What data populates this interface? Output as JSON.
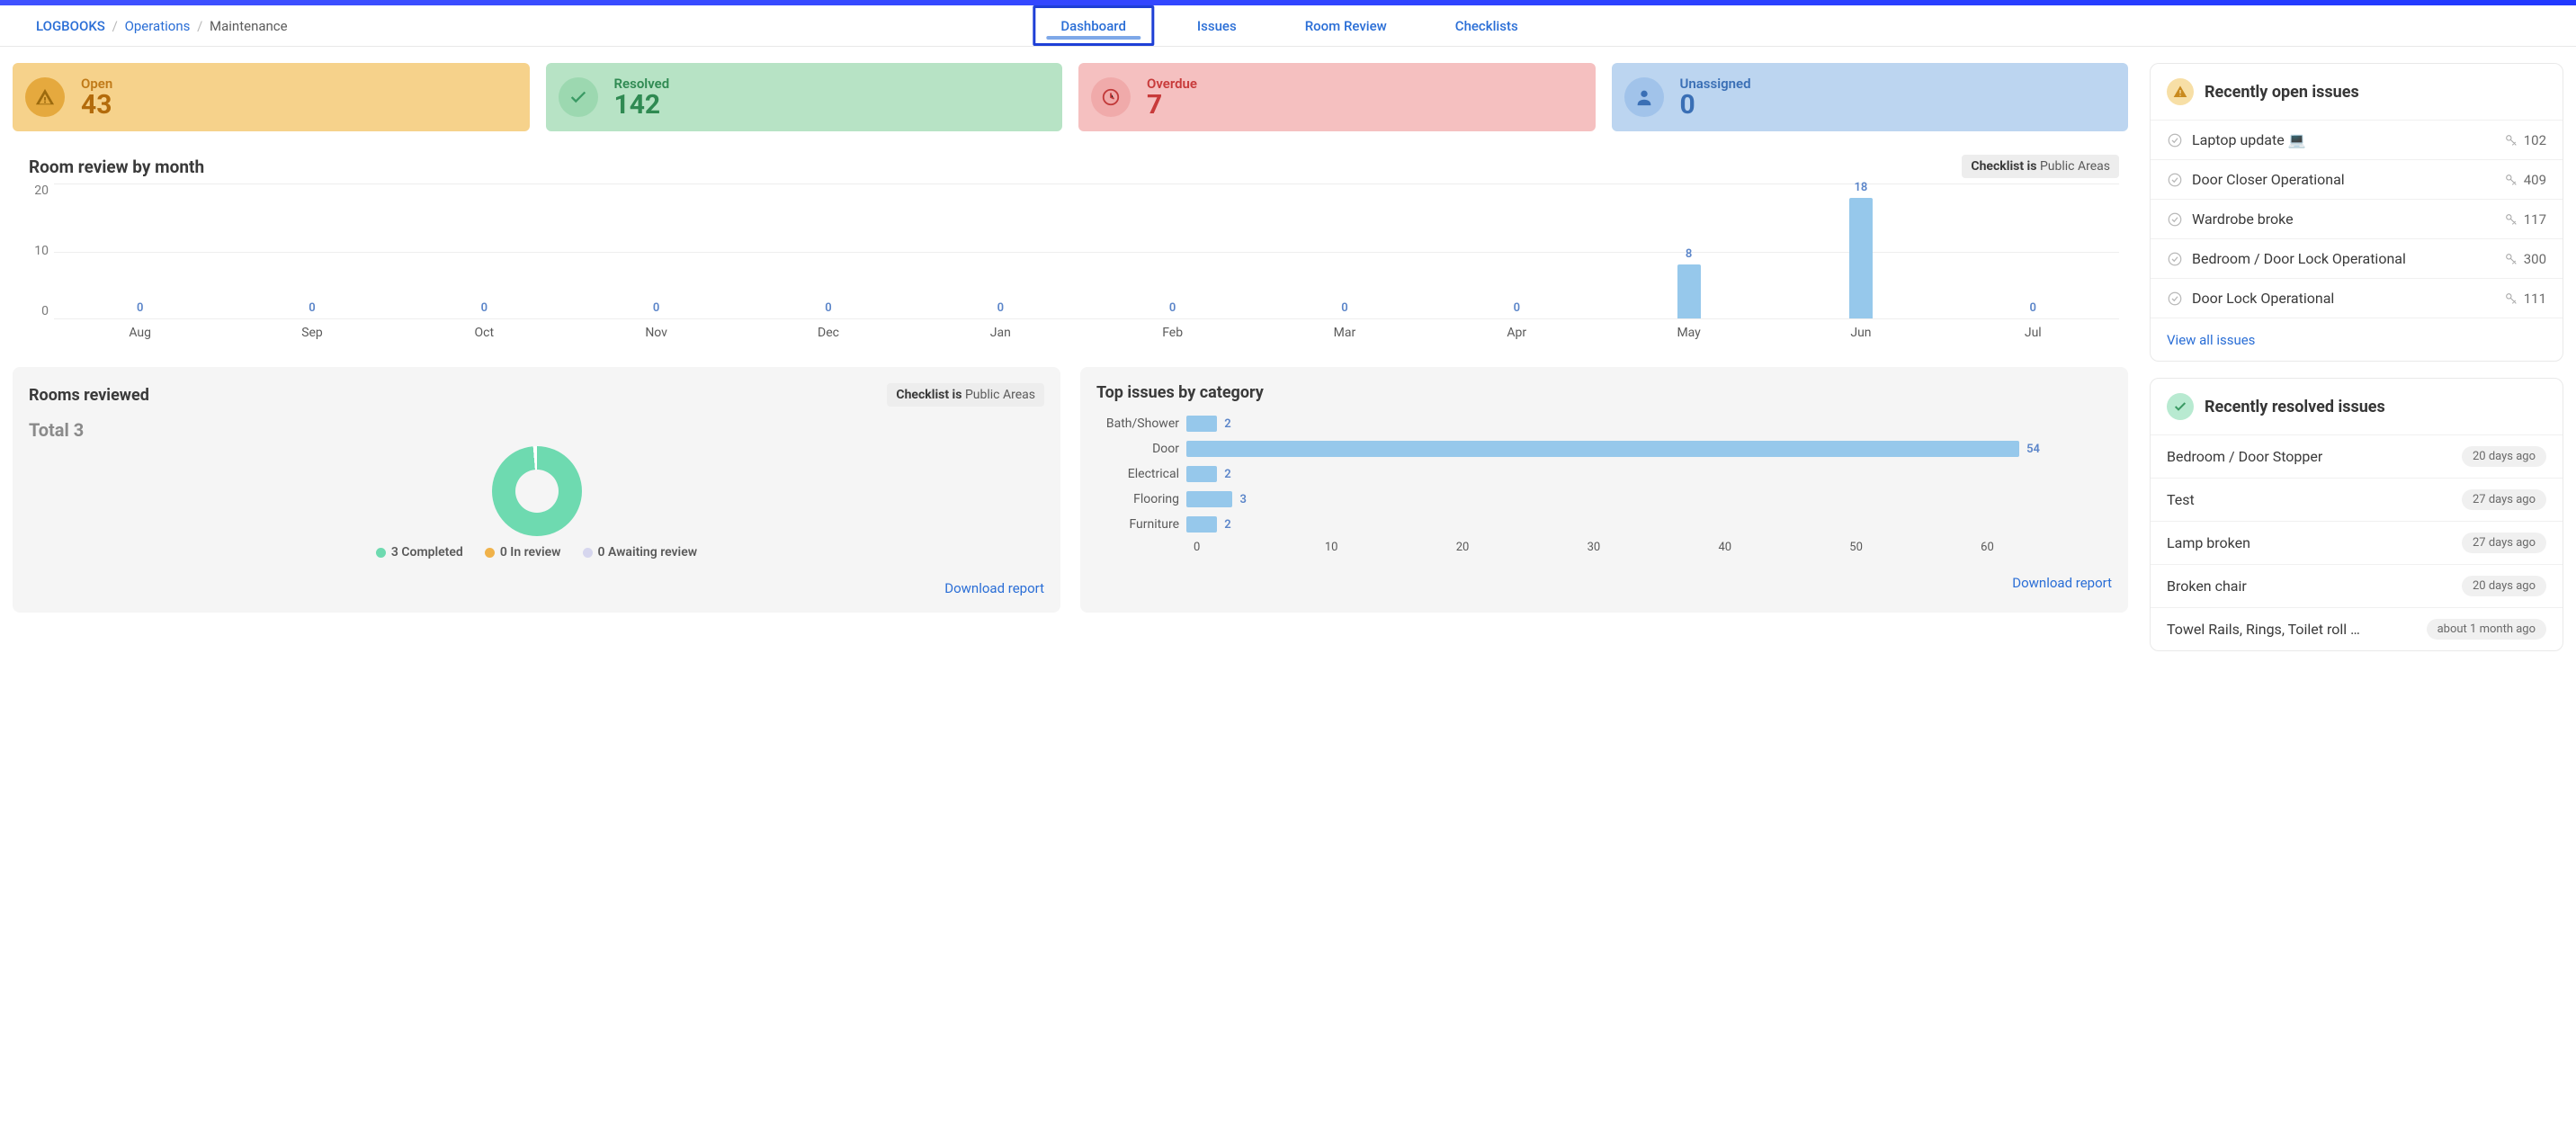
{
  "breadcrumb": {
    "root": "LOGBOOKS",
    "mid": "Operations",
    "leaf": "Maintenance"
  },
  "tabs": {
    "dashboard": "Dashboard",
    "issues": "Issues",
    "room_review": "Room Review",
    "checklists": "Checklists"
  },
  "cards": {
    "open": {
      "label": "Open",
      "value": "43"
    },
    "resolved": {
      "label": "Resolved",
      "value": "142"
    },
    "overdue": {
      "label": "Overdue",
      "value": "7"
    },
    "unassigned": {
      "label": "Unassigned",
      "value": "0"
    }
  },
  "room_review_chart": {
    "title": "Room review by month",
    "chip_prefix": "Checklist is",
    "chip_value": "Public Areas"
  },
  "chart_data": [
    {
      "type": "bar",
      "title": "Room review by month",
      "categories": [
        "Aug",
        "Sep",
        "Oct",
        "Nov",
        "Dec",
        "Jan",
        "Feb",
        "Mar",
        "Apr",
        "May",
        "Jun",
        "Jul"
      ],
      "values": [
        0,
        0,
        0,
        0,
        0,
        0,
        0,
        0,
        0,
        8,
        18,
        0
      ],
      "xlabel": "",
      "ylabel": "",
      "ylim": [
        0,
        20
      ],
      "yticks": [
        0,
        10,
        20
      ]
    },
    {
      "type": "bar",
      "orientation": "horizontal",
      "title": "Top issues by category",
      "categories": [
        "Bath/Shower",
        "Door",
        "Electrical",
        "Flooring",
        "Furniture"
      ],
      "values": [
        2,
        54,
        2,
        3,
        2
      ],
      "xlim": [
        0,
        60
      ],
      "xticks": [
        0,
        10,
        20,
        30,
        40,
        50,
        60
      ]
    }
  ],
  "rooms_reviewed": {
    "title": "Rooms reviewed",
    "chip_prefix": "Checklist is",
    "chip_value": "Public Areas",
    "total_label": "Total 3",
    "legend": {
      "completed": "3 Completed",
      "in_review": "0 In review",
      "awaiting": "0 Awaiting review"
    },
    "download": "Download report"
  },
  "top_issues": {
    "title": "Top issues by category",
    "download": "Download report"
  },
  "open_panel": {
    "title": "Recently open issues",
    "items": [
      {
        "label": "Laptop update 💻",
        "count": "102"
      },
      {
        "label": "Door Closer Operational",
        "count": "409"
      },
      {
        "label": "Wardrobe broke",
        "count": "117"
      },
      {
        "label": "Bedroom / Door Lock Operational",
        "count": "300"
      },
      {
        "label": "Door Lock Operational",
        "count": "111"
      }
    ],
    "view_all": "View all issues"
  },
  "resolved_panel": {
    "title": "Recently resolved issues",
    "items": [
      {
        "label": "Bedroom / Door Stopper",
        "time": "20 days ago"
      },
      {
        "label": "Test",
        "time": "27 days ago"
      },
      {
        "label": "Lamp broken",
        "time": "27 days ago"
      },
      {
        "label": "Broken chair",
        "time": "20 days ago"
      },
      {
        "label": "Towel Rails, Rings, Toilet roll …",
        "time": "about 1 month ago"
      }
    ]
  }
}
